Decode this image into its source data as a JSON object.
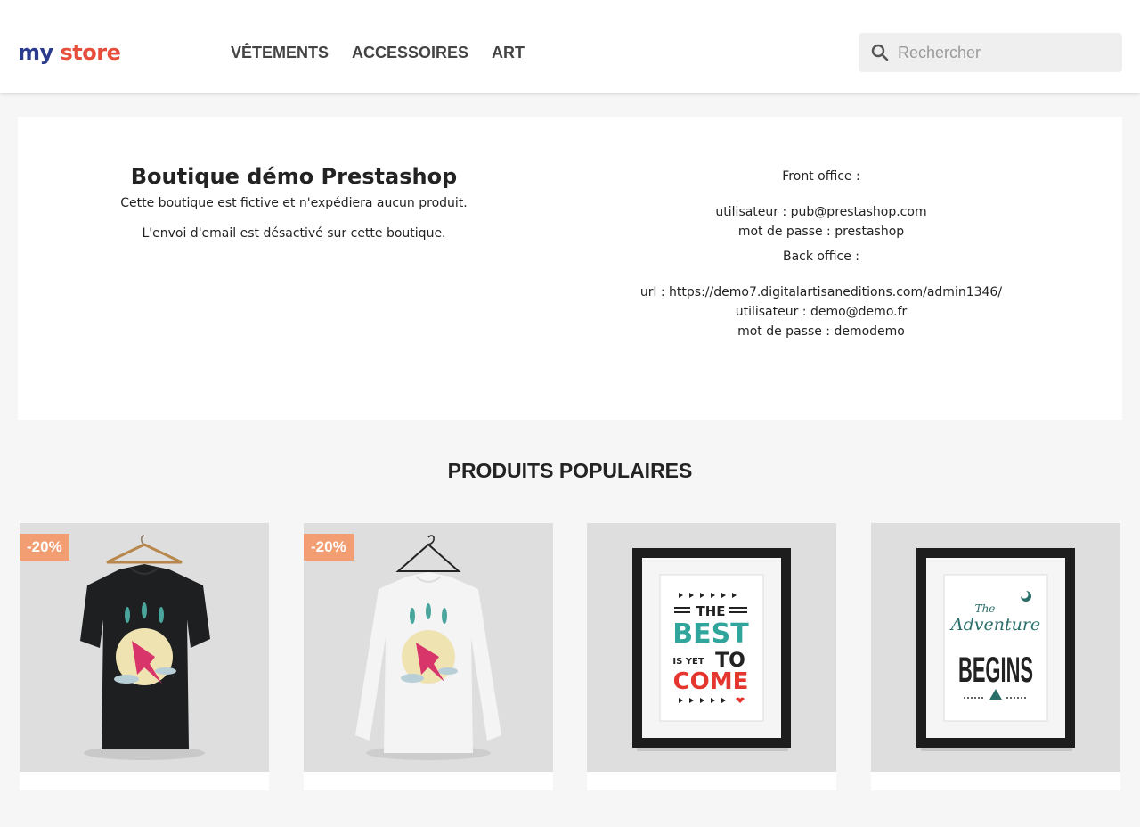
{
  "header": {
    "logo": {
      "part1": "my",
      "part2": "store"
    },
    "nav": [
      "VÊTEMENTS",
      "ACCESSOIRES",
      "ART"
    ],
    "search": {
      "placeholder": "Rechercher",
      "icon": "search-icon"
    }
  },
  "banner": {
    "title": "Boutique démo Prestashop",
    "line1": "Cette boutique est fictive et n'expédiera aucun produit.",
    "line2": "L'envoi d'email est désactivé sur cette boutique.",
    "front_office_label": "Front office :",
    "front_user": "utilisateur : pub@prestashop.com",
    "front_pass": "mot de passe : prestashop",
    "back_office_label": "Back office :",
    "back_url": "url : https://demo7.digitalartisaneditions.com/admin1346/",
    "back_user": "utilisateur : demo@demo.fr",
    "back_pass": "mot de passe : demodemo"
  },
  "section_title": "PRODUITS POPULAIRES",
  "products": [
    {
      "badge": "-20%",
      "image": "black-tshirt-hummingbird"
    },
    {
      "badge": "-20%",
      "image": "white-sweater-hummingbird"
    },
    {
      "image": "framed-poster-best-is-yet-to-come",
      "poster_text": [
        "THE",
        "BEST",
        "IS YET",
        "TO",
        "COME"
      ]
    },
    {
      "image": "framed-poster-adventure-begins",
      "poster_text": [
        "The",
        "Adventure",
        "BEGINS"
      ]
    }
  ],
  "colors": {
    "badge": "#f39d72",
    "poster_teal": "#2fa59c",
    "poster_red": "#e5352f"
  }
}
